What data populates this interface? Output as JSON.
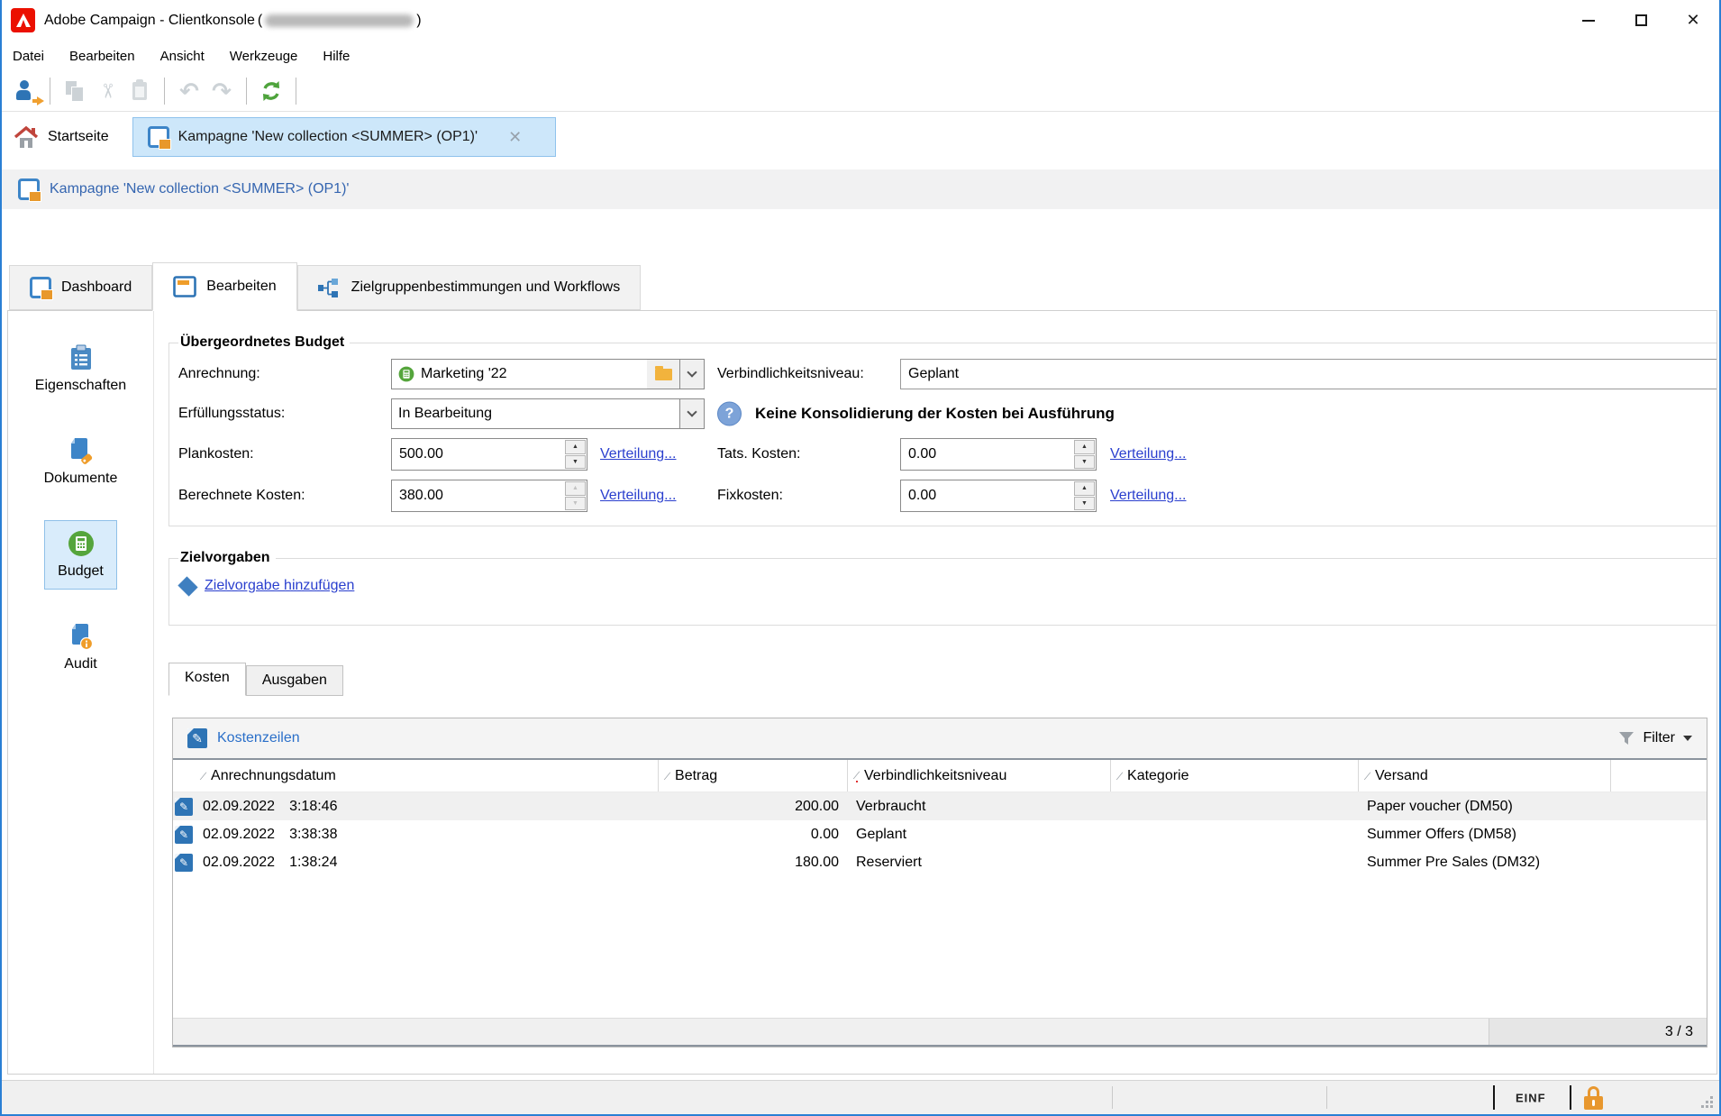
{
  "titlebar": {
    "app_title": "Adobe Campaign - Clientkonsole",
    "paren_open": "(",
    "paren_close": ")"
  },
  "menubar": {
    "items": [
      "Datei",
      "Bearbeiten",
      "Ansicht",
      "Werkzeuge",
      "Hilfe"
    ]
  },
  "toolbar": {
    "icons": [
      "connect-icon",
      "copy-icon",
      "cut-icon",
      "paste-icon",
      "undo-icon",
      "redo-icon",
      "refresh-icon"
    ]
  },
  "tabbar": {
    "home_label": "Startseite",
    "campaign_tab_label": "Kampagne 'New collection <SUMMER> (OP1)'"
  },
  "breadcrumb": {
    "label": "Kampagne 'New collection <SUMMER> (OP1)'"
  },
  "main_tabs": {
    "items": [
      "Dashboard",
      "Bearbeiten",
      "Zielgruppenbestimmungen und Workflows"
    ],
    "active": "Bearbeiten"
  },
  "sidebar": {
    "items": [
      {
        "label": "Eigenschaften",
        "icon": "clipboard-icon"
      },
      {
        "label": "Dokumente",
        "icon": "document-tag-icon"
      },
      {
        "label": "Budget",
        "icon": "calculator-icon",
        "selected": true
      },
      {
        "label": "Audit",
        "icon": "document-info-icon"
      }
    ]
  },
  "budget_form": {
    "legend": "Übergeordnetes Budget",
    "anrechnung_label": "Anrechnung:",
    "anrechnung_value": "Marketing '22",
    "verbindlichkeitsniveau_label": "Verbindlichkeitsniveau:",
    "verbindlichkeitsniveau_value": "Geplant",
    "erfuellungsstatus_label": "Erfüllungsstatus:",
    "erfuellungsstatus_value": "In Bearbeitung",
    "warning_text": "Keine Konsolidierung der Kosten bei Ausführung",
    "plankosten_label": "Plankosten:",
    "plankosten_value": "500.00",
    "tats_kosten_label": "Tats. Kosten:",
    "tats_kosten_value": "0.00",
    "berechnete_kosten_label": "Berechnete Kosten:",
    "berechnete_kosten_value": "380.00",
    "fixkosten_label": "Fixkosten:",
    "fixkosten_value": "0.00",
    "verteilung_link": "Verteilung..."
  },
  "zielvorgaben": {
    "legend": "Zielvorgaben",
    "add_link": "Zielvorgabe hinzufügen"
  },
  "costs_section": {
    "tabs": [
      "Kosten",
      "Ausgaben"
    ],
    "active_tab": "Kosten",
    "toolbar_link": "Kostenzeilen",
    "filter_label": "Filter",
    "columns": [
      "Anrechnungsdatum",
      "Betrag",
      "Verbindlichkeitsniveau",
      "Kategorie",
      "Versand"
    ],
    "rows": [
      {
        "date": "02.09.2022",
        "time": "3:18:46",
        "betrag": "200.00",
        "verbindlichkeitsniveau": "Verbraucht",
        "kategorie": "",
        "versand": "Paper voucher (DM50)"
      },
      {
        "date": "02.09.2022",
        "time": "3:38:38",
        "betrag": "0.00",
        "verbindlichkeitsniveau": "Geplant",
        "kategorie": "",
        "versand": "Summer Offers (DM58)"
      },
      {
        "date": "02.09.2022",
        "time": "1:38:24",
        "betrag": "180.00",
        "verbindlichkeitsniveau": "Reserviert",
        "kategorie": "",
        "versand": "Summer Pre Sales (DM32)"
      }
    ],
    "count": "3 / 3"
  },
  "statusbar": {
    "insert_mode": "EINF"
  },
  "colors": {
    "accent_blue": "#2e74b5",
    "selection_blue": "#cde7fa",
    "link_blue": "#2a3fce",
    "green": "#55a53c",
    "orange": "#e8972e",
    "window_border": "#2a7fd4"
  }
}
